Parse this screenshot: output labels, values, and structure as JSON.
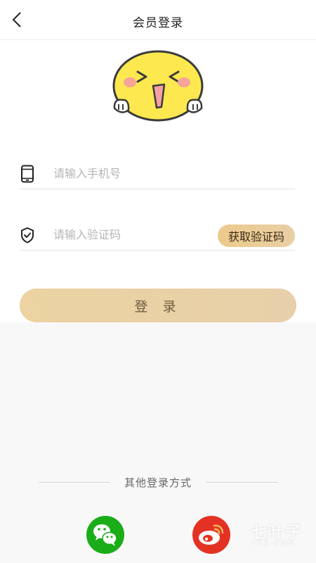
{
  "header": {
    "title": "会员登录",
    "back_icon": "chevron-left-icon"
  },
  "mascot": {
    "icon": "laughing-face-mascot",
    "colors": {
      "face": "#fde84f",
      "outline": "#3b3b3b",
      "cheek": "#f4a49a",
      "mouth": "#f5a0a3"
    }
  },
  "form": {
    "phone": {
      "icon": "phone-icon",
      "placeholder": "请输入手机号",
      "value": ""
    },
    "code": {
      "icon": "shield-check-icon",
      "placeholder": "请输入验证码",
      "value": "",
      "button_label": "获取验证码"
    },
    "login_label": "登 录"
  },
  "other_login": {
    "label": "其他登录方式",
    "providers": [
      {
        "name": "wechat",
        "icon": "wechat-icon",
        "color": "#1aad19"
      },
      {
        "name": "weibo",
        "icon": "weibo-icon",
        "color": "#e33224"
      }
    ]
  },
  "watermark": {
    "title": "七叶子",
    "subtitle": "7YZ.COM"
  },
  "colors": {
    "accent": "#ecd3a1",
    "lower_background": "#f8f8f8"
  }
}
